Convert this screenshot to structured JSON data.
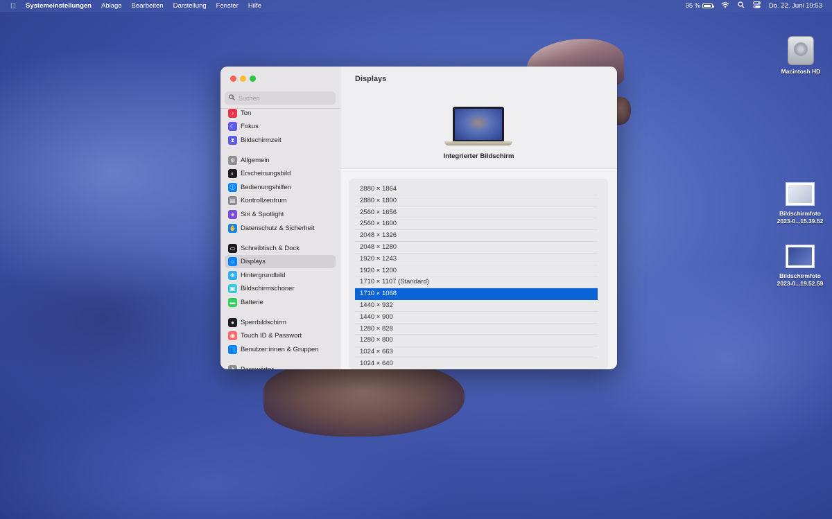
{
  "menubar": {
    "apple_icon": "apple-logo",
    "app_name": "Systemeinstellungen",
    "menus": [
      "Ablage",
      "Bearbeiten",
      "Darstellung",
      "Fenster",
      "Hilfe"
    ],
    "battery_percent": "95 %",
    "battery_level": 0.95,
    "date_time": "Do. 22. Juni  19:53"
  },
  "desktop": {
    "icons": [
      {
        "label": "Macintosh HD"
      },
      {
        "label_line1": "Bildschirmfoto",
        "label_line2": "2023-0...15.39.52"
      },
      {
        "label_line1": "Bildschirmfoto",
        "label_line2": "2023-0...19.52.59"
      }
    ]
  },
  "window": {
    "search_placeholder": "Suchen",
    "sidebar": [
      {
        "label": "Ton",
        "icon": "speaker-icon",
        "color": "#e8334a"
      },
      {
        "label": "Fokus",
        "icon": "moon-icon",
        "color": "#5e5ce6"
      },
      {
        "label": "Bildschirmzeit",
        "icon": "hourglass-icon",
        "color": "#5e5ce6"
      },
      {
        "label": "Allgemein",
        "icon": "gear-icon",
        "color": "#8e8e93"
      },
      {
        "label": "Erscheinungsbild",
        "icon": "appearance-icon",
        "color": "#1c1c1e"
      },
      {
        "label": "Bedienungshilfen",
        "icon": "accessibility-icon",
        "color": "#0a84ff"
      },
      {
        "label": "Kontrollzentrum",
        "icon": "control-center-icon",
        "color": "#8e8e93"
      },
      {
        "label": "Siri & Spotlight",
        "icon": "siri-icon",
        "color": "#7d4cdb"
      },
      {
        "label": "Datenschutz & Sicherheit",
        "icon": "hand-icon",
        "color": "#0a84ff"
      },
      {
        "label": "Schreibtisch & Dock",
        "icon": "dock-icon",
        "color": "#1c1c1e"
      },
      {
        "label": "Displays",
        "icon": "sun-icon",
        "color": "#0a84ff"
      },
      {
        "label": "Hintergrundbild",
        "icon": "wallpaper-icon",
        "color": "#30b0f0"
      },
      {
        "label": "Bildschirmschoner",
        "icon": "screensaver-icon",
        "color": "#40c8e0"
      },
      {
        "label": "Batterie",
        "icon": "battery-icon",
        "color": "#30d158"
      },
      {
        "label": "Sperrbildschirm",
        "icon": "lock-icon",
        "color": "#1c1c1e"
      },
      {
        "label": "Touch ID & Passwort",
        "icon": "fingerprint-icon",
        "color": "#ff6b6b"
      },
      {
        "label": "Benutzer:innen & Gruppen",
        "icon": "users-icon",
        "color": "#0a84ff"
      },
      {
        "label": "Passwörter",
        "icon": "key-icon",
        "color": "#8e8e93"
      }
    ],
    "selected_item": "Displays",
    "main": {
      "title": "Displays",
      "display_name": "Integrierter Bildschirm",
      "resolutions": [
        "2880 × 1864",
        "2880 × 1800",
        "2560 × 1656",
        "2560 × 1600",
        "2048 × 1326",
        "2048 × 1280",
        "1920 × 1243",
        "1920 × 1200",
        "1710 × 1107 (Standard)",
        "1710 × 1068",
        "1440 × 932",
        "1440 × 900",
        "1280 × 828",
        "1280 × 800",
        "1024 × 663",
        "1024 × 640"
      ],
      "selected_resolution": "1710 × 1068"
    }
  }
}
